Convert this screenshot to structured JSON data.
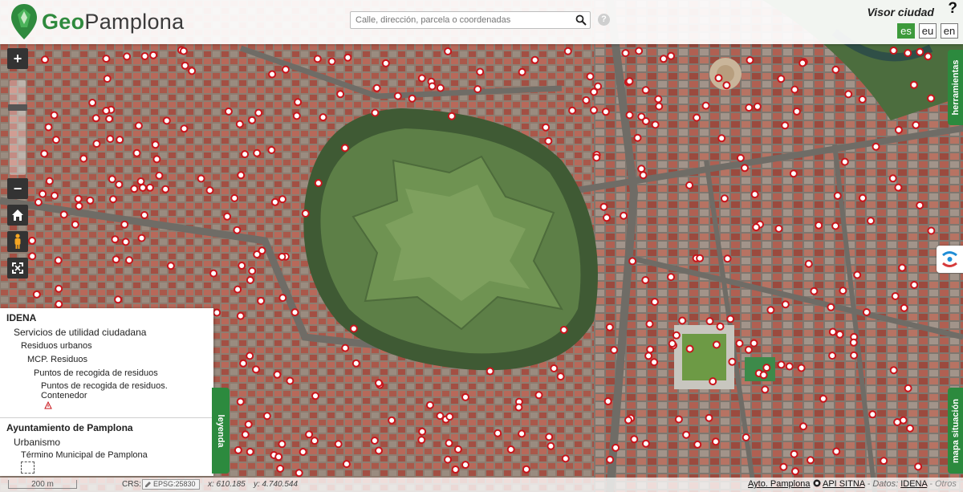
{
  "header": {
    "logo_geo": "Geo",
    "logo_pamplona": "Pamplona",
    "search_placeholder": "Calle, dirección, parcela o coordenadas",
    "search_help": "?",
    "title": "Visor ciudad",
    "help": "?",
    "languages": [
      {
        "code": "es",
        "active": true
      },
      {
        "code": "eu",
        "active": false
      },
      {
        "code": "en",
        "active": false
      }
    ]
  },
  "map_controls": {
    "zoom_in": "+",
    "zoom_out": "−"
  },
  "tabs": {
    "herramientas": "herramientas",
    "mapa_situacion": "mapa situación",
    "leyenda": "leyenda"
  },
  "legend": {
    "group1": {
      "title": "IDENA",
      "service": "Servicios de utilidad ciudadana",
      "level1": "Residuos urbanos",
      "level2": "MCP. Residuos",
      "level3": "Puntos de recogida de residuos",
      "layer_line1": "Puntos de recogida de residuos.",
      "layer_line2": "Contenedor"
    },
    "group2": {
      "title": "Ayuntamiento de Pamplona",
      "service": "Urbanismo",
      "layer": "Término Municipal de Pamplona"
    }
  },
  "status": {
    "scale": "200 m",
    "crs_label": "CRS:",
    "crs_value": "EPSG:25830",
    "x": "x: 610.185",
    "y": "y: 4.740.544",
    "credit1": "Ayto. Pamplona",
    "credit2": "API SITNA",
    "data_label": "- Datos:",
    "data_source": "IDENA",
    "others": "- Otros"
  },
  "colors": {
    "brand_green": "#2f8a3e",
    "tab_green": "#2c8a3e",
    "marker_red": "#c9141b"
  }
}
